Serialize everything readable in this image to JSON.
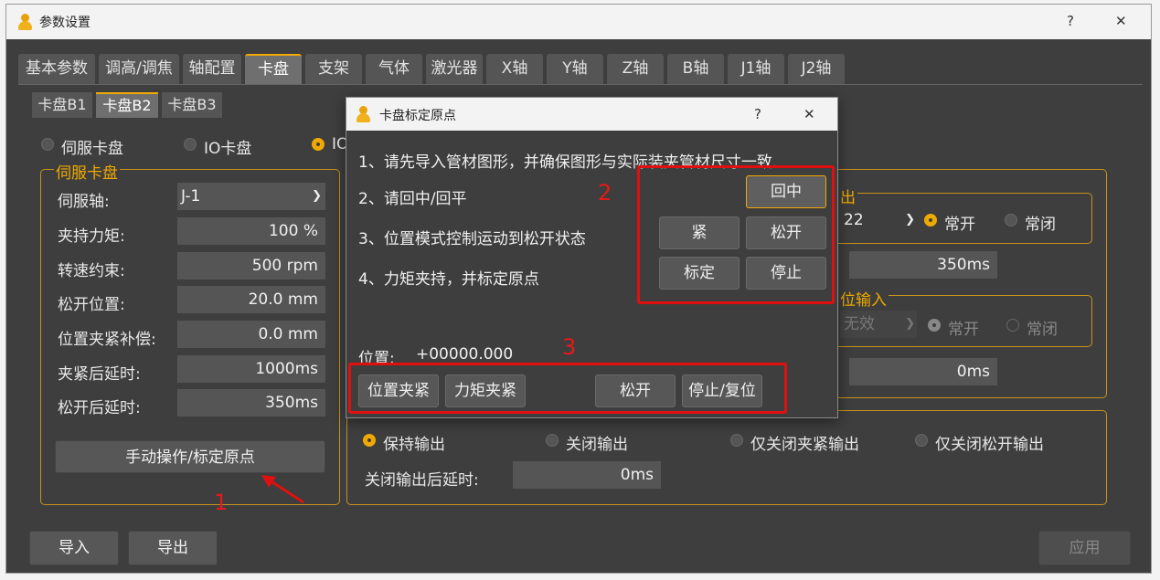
{
  "window": {
    "title": "参数设置",
    "help": "?",
    "close": "✕"
  },
  "tabs": [
    "基本参数",
    "调高/调焦",
    "轴配置",
    "卡盘",
    "支架",
    "气体",
    "激光器",
    "X轴",
    "Y轴",
    "Z轴",
    "B轴",
    "J1轴",
    "J2轴"
  ],
  "active_tab": "卡盘",
  "subtabs": [
    "卡盘B1",
    "卡盘B2",
    "卡盘B3"
  ],
  "active_subtab": "卡盘B2",
  "chuck_type": {
    "servo": "伺服卡盘",
    "io": "IO卡盘",
    "io2": "IO"
  },
  "servo_group": {
    "title": "伺服卡盘",
    "rows": [
      {
        "label": "伺服轴:",
        "value": "J-1"
      },
      {
        "label": "夹持力矩:",
        "value": "100 %"
      },
      {
        "label": "转速约束:",
        "value": "500 rpm"
      },
      {
        "label": "松开位置:",
        "value": "20.0 mm"
      },
      {
        "label": "位置夹紧补偿:",
        "value": "0.0 mm"
      },
      {
        "label": "夹紧后延时:",
        "value": "1000ms"
      },
      {
        "label": "松开后延时:",
        "value": "350ms"
      }
    ],
    "manual_button": "手动操作/标定原点"
  },
  "io_right": {
    "output_title_tail": "出",
    "output_select": "22",
    "no": "常开",
    "nc": "常闭",
    "delay1": "350ms",
    "input_title_tail": "位输入",
    "input_select": "无效",
    "delay2": "0ms"
  },
  "output_mode": {
    "options": [
      "保持输出",
      "关闭输出",
      "仅关闭夹紧输出",
      "仅关闭松开输出"
    ],
    "delay_label": "关闭输出后延时:",
    "delay_value": "0ms"
  },
  "footer": {
    "import": "导入",
    "export": "导出",
    "apply": "应用"
  },
  "dialog": {
    "title": "卡盘标定原点",
    "help": "?",
    "close": "✕",
    "steps": [
      "1、请先导入管材图形，并确保图形与实际装夹管材尺寸一致.",
      "2、请回中/回平",
      "3、位置模式控制运动到松开状态",
      "4、力矩夹持，并标定原点"
    ],
    "btn_center": "回中",
    "btn_clamp": "紧",
    "btn_release": "松开",
    "btn_calibrate": "标定",
    "btn_stop": "停止",
    "position_label": "位置:",
    "position_value": "+00000.000",
    "bottom_buttons": [
      "位置夹紧",
      "力矩夹紧",
      "松开",
      "停止/复位"
    ]
  },
  "annotations": {
    "n1": "1",
    "n2": "2",
    "n3": "3"
  },
  "colors": {
    "accent": "#f0a900",
    "annotation": "#e01010",
    "background": "#3e3e3e"
  }
}
